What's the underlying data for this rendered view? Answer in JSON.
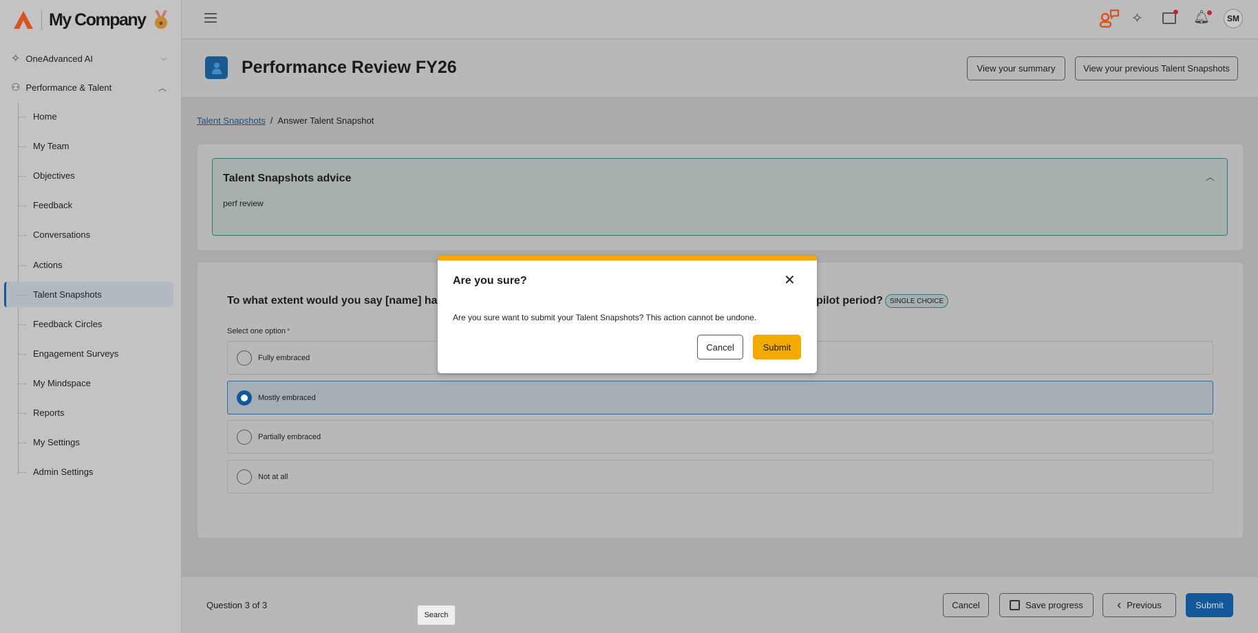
{
  "brand": {
    "name": "My Company"
  },
  "sidebar": {
    "groups": [
      {
        "label": "OneAdvanced AI",
        "icon": "sparkles-icon",
        "expanded": false
      },
      {
        "label": "Performance & Talent",
        "icon": "people-stars-icon",
        "expanded": true
      }
    ],
    "items": [
      {
        "label": "Home"
      },
      {
        "label": "My Team"
      },
      {
        "label": "Objectives"
      },
      {
        "label": "Feedback"
      },
      {
        "label": "Conversations"
      },
      {
        "label": "Actions"
      },
      {
        "label": "Talent Snapshots",
        "active": true
      },
      {
        "label": "Feedback Circles"
      },
      {
        "label": "Engagement Surveys"
      },
      {
        "label": "My Mindspace"
      },
      {
        "label": "Reports"
      },
      {
        "label": "My Settings"
      },
      {
        "label": "Admin Settings"
      }
    ]
  },
  "topbar": {
    "avatar_initials": "SM"
  },
  "header": {
    "title": "Performance Review FY26",
    "summary_button": "View your summary",
    "previous_button": "View your previous Talent Snapshots"
  },
  "breadcrumb": {
    "link": "Talent Snapshots",
    "separator": "/",
    "current": "Answer Talent Snapshot"
  },
  "advice": {
    "title": "Talent Snapshots advice",
    "body": "perf review"
  },
  "question": {
    "text_start": "To what extent would you say [name] has",
    "text_end": "pilot period?",
    "badge": "SINGLE CHOICE",
    "select_label": "Select one option",
    "required_mark": "*",
    "options": [
      {
        "label": "Fully embraced",
        "selected": false
      },
      {
        "label": "Mostly embraced",
        "selected": true
      },
      {
        "label": "Partially embraced",
        "selected": false
      },
      {
        "label": "Not at all",
        "selected": false
      }
    ]
  },
  "footer": {
    "progress": "Question 3 of 3",
    "cancel": "Cancel",
    "save": "Save progress",
    "previous": "Previous",
    "submit": "Submit"
  },
  "tooltip": {
    "text": "Search"
  },
  "dialog": {
    "title": "Are you sure?",
    "message": "Are you sure want to submit your Talent Snapshots? This action cannot be undone.",
    "cancel": "Cancel",
    "submit": "Submit"
  },
  "colors": {
    "accent": "#f2a900",
    "primary": "#12589a",
    "brand_orange": "#d9531e",
    "teal": "#2d7a78"
  }
}
